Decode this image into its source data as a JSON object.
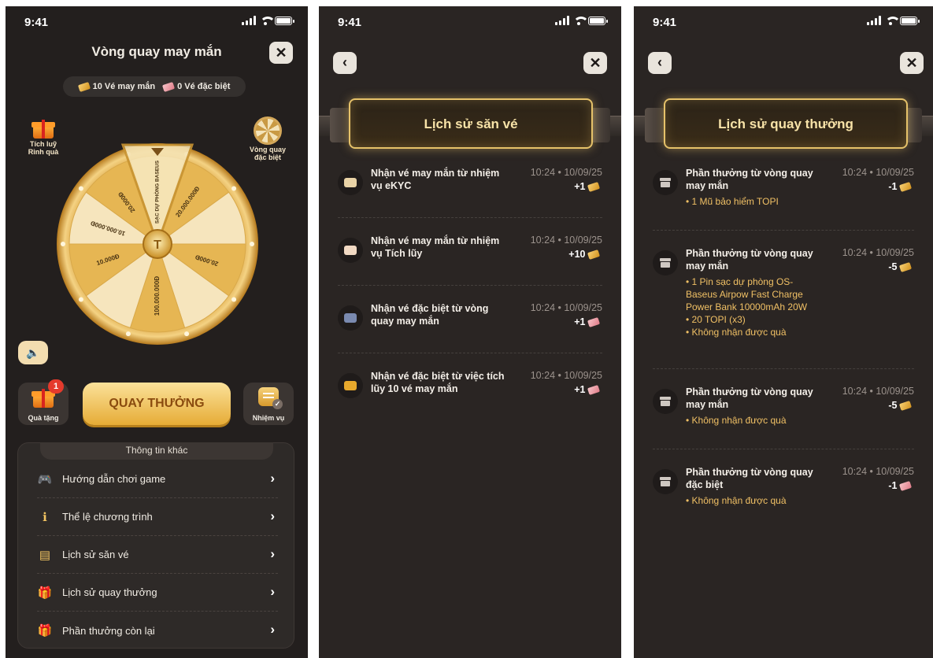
{
  "status": {
    "time": "9:41"
  },
  "screen1": {
    "title": "Vòng quay may mắn",
    "tickets": {
      "lucky": "10 Vé may mắn",
      "special": "0 Vé đặc biệt"
    },
    "left_float_label": "Tích luỹ Rinh quà",
    "right_float_label": "Vòng quay đặc biệt",
    "wheel_segments": [
      "SẠC DỰ PHÒNG BASEUS",
      "20.000.000Đ",
      "",
      "20.000Đ",
      "",
      "100.000.000Đ",
      "",
      "10.000Đ",
      "10.000.000Đ",
      "20.000Đ"
    ],
    "gift_badge": "1",
    "gift_label": "Quà tặng",
    "spin_label": "QUAY THƯỞNG",
    "task_label": "Nhiệm vụ",
    "info_title": "Thông tin khác",
    "info_items": [
      {
        "label": "Hướng dẫn chơi game",
        "icon": "gamepad-icon"
      },
      {
        "label": "Thể lệ chương trình",
        "icon": "info-icon"
      },
      {
        "label": "Lịch sử săn vé",
        "icon": "ticket-history-icon"
      },
      {
        "label": "Lịch sử quay thưởng",
        "icon": "gift-history-icon"
      },
      {
        "label": "Phần thưởng còn lại",
        "icon": "gift-icon"
      }
    ]
  },
  "screen2": {
    "title": "Lịch sử săn vé",
    "records": [
      {
        "title_l1": "Nhận vé may mắn từ nhiệm",
        "title_l2": "vụ eKYC",
        "time": "10:24 • 10/09/25",
        "amount": "+1",
        "ticket": "gold"
      },
      {
        "title_l1": "Nhận vé may mắn từ nhiệm",
        "title_l2": "vụ Tích lũy",
        "time": "10:24 • 10/09/25",
        "amount": "+10",
        "ticket": "gold"
      },
      {
        "title_l1": "Nhận vé đặc biệt từ vòng",
        "title_l2": "quay may mắn",
        "time": "10:24 • 10/09/25",
        "amount": "+1",
        "ticket": "pink"
      },
      {
        "title_l1": "Nhận vé đặc biệt từ việc tích",
        "title_l2": "lũy 10 vé may mắn",
        "time": "10:24 • 10/09/25",
        "amount": "+1",
        "ticket": "pink"
      }
    ]
  },
  "screen3": {
    "title": "Lịch sử quay thưởng",
    "records": [
      {
        "title_l1": "Phần thưởng từ vòng quay",
        "title_l2": "may mắn",
        "time": "10:24 • 10/09/25",
        "amount": "-1",
        "ticket": "gold",
        "rewards": [
          "• 1 Mũ bảo hiểm TOPI"
        ]
      },
      {
        "title_l1": "Phần thưởng từ vòng quay",
        "title_l2": "may mắn",
        "time": "10:24 • 10/09/25",
        "amount": "-5",
        "ticket": "gold",
        "rewards": [
          "• 1 Pin sạc dự phòng OS-",
          "Baseus Airpow Fast Charge",
          "Power Bank 10000mAh 20W",
          "• 20 TOPI (x3)",
          "• Không nhận được quà"
        ]
      },
      {
        "title_l1": "Phần thưởng từ vòng quay",
        "title_l2": "may mắn",
        "time": "10:24 • 10/09/25",
        "amount": "-5",
        "ticket": "gold",
        "rewards": [
          "• Không nhận được quà"
        ]
      },
      {
        "title_l1": "Phần thưởng từ vòng quay",
        "title_l2": "đặc biệt",
        "time": "10:24 • 10/09/25",
        "amount": "-1",
        "ticket": "pink",
        "rewards": [
          "• Không nhận được quà"
        ]
      }
    ]
  },
  "colors": {
    "accent_gold": "#f0c065",
    "background": "#231f1e",
    "ticket_gold": "#e8a92c",
    "ticket_pink": "#e07a87"
  }
}
